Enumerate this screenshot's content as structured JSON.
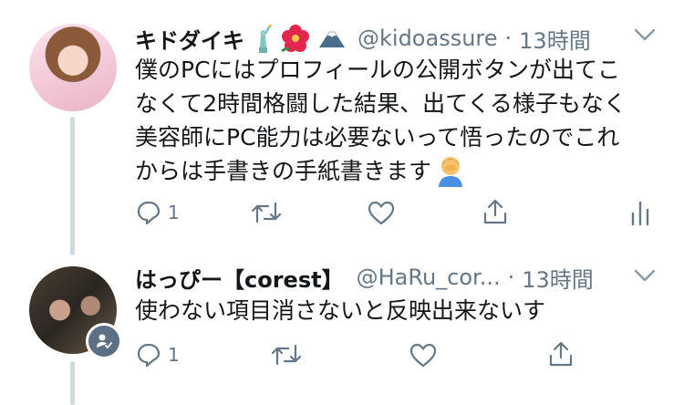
{
  "tweets": [
    {
      "name": "キドダイキ",
      "name_emojis": [
        "statue-of-liberty",
        "hibiscus",
        "mount-fuji"
      ],
      "handle": "@kidoassure",
      "separator": "·",
      "time": "13時間",
      "lines": [
        "僕のPCにはプロフィールの公開ボタンが出てこ",
        "なくて2時間格闘した結果、出てくる様子もなく",
        "美容師にPC能力は必要ないって悟ったのでこれ",
        "からは手書きの手紙書きます"
      ],
      "trailing_emoji": "person-facepalming",
      "reply_count": "1",
      "actions": [
        "reply-icon",
        "retweet-icon",
        "like-icon",
        "share-icon",
        "analytics-icon"
      ]
    },
    {
      "name": "はっぴー【corest】",
      "handle": "@HaRu_cor...",
      "separator": "·",
      "time": "13時間",
      "lines": [
        "使わない項目消さないと反映出来ないす"
      ],
      "reply_count": "1",
      "actions": [
        "reply-icon",
        "retweet-icon",
        "like-icon",
        "share-icon"
      ]
    }
  ],
  "colors": {
    "text": "#14171a",
    "secondary": "#657786",
    "thread_line": "#cfd9de",
    "icon": "#657786"
  }
}
